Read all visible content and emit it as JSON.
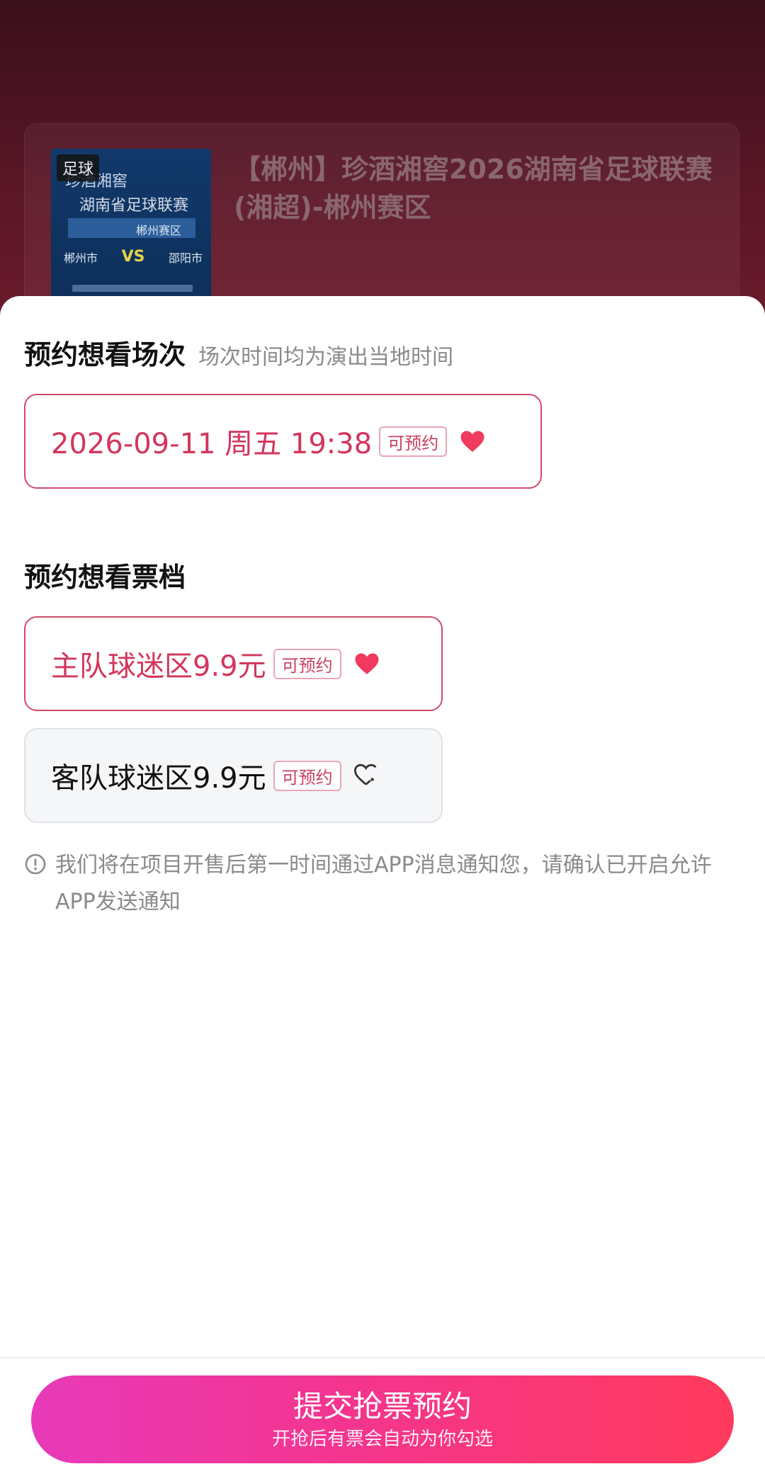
{
  "event": {
    "sport_tag": "足球",
    "title": "【郴州】珍酒湘窖2026湖南省足球联赛(湘超)-郴州赛区",
    "poster": {
      "line1": "珍酒湘窖",
      "line2": "湖南省足球联赛",
      "zone": "郴州赛区",
      "team_home": "郴州市",
      "vs": "VS",
      "team_away": "邵阳市"
    }
  },
  "session": {
    "title": "预约想看场次",
    "subtitle": "场次时间均为演出当地时间",
    "options": [
      {
        "label": "2026-09-11 周五 19:38",
        "badge": "可预约",
        "selected": true,
        "icon": "heart-filled-icon"
      }
    ]
  },
  "tier": {
    "title": "预约想看票档",
    "options": [
      {
        "label": "主队球迷区9.9元",
        "badge": "可预约",
        "selected": true,
        "icon": "heart-filled-icon"
      },
      {
        "label": "客队球迷区9.9元",
        "badge": "可预约",
        "selected": false,
        "icon": "heart-add-icon"
      }
    ]
  },
  "notice": {
    "icon": "info-icon",
    "text": "我们将在项目开售后第一时间通过APP消息通知您，请确认已开启允许APP发送通知"
  },
  "submit": {
    "label": "提交抢票预约",
    "sublabel": "开抢后有票会自动为你勾选"
  },
  "colors": {
    "accent": "#d2365b",
    "button_start": "#e83ab9",
    "button_end": "#ff3a5c"
  }
}
